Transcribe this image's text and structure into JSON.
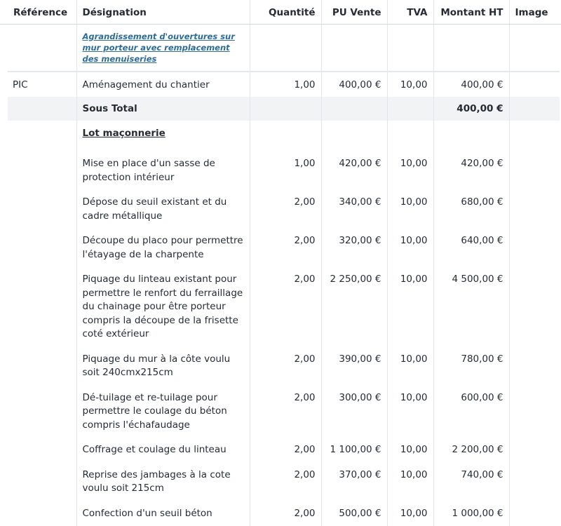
{
  "columns": {
    "reference": "Référence",
    "designation": "Désignation",
    "quantite": "Quantité",
    "pu_vente": "PU Vente",
    "tva": "TVA",
    "montant_ht": "Montant HT",
    "image": "Image"
  },
  "title_row": {
    "link_text": "Agrandissement d'ouvertures sur mur porteur avec remplacement des menuiseries"
  },
  "pic_row": {
    "reference": "PIC",
    "designation": "Aménagement du chantier",
    "quantite": "1,00",
    "pu_vente": "400,00 €",
    "tva": "10,00",
    "montant_ht": "400,00 €"
  },
  "subtotal": {
    "label": "Sous Total",
    "montant_ht": "400,00 €"
  },
  "lot": {
    "title": "Lot maçonnerie",
    "items": [
      {
        "designation": "Mise en place d'un sasse de protection intérieur",
        "quantite": "1,00",
        "pu_vente": "420,00 €",
        "tva": "10,00",
        "montant_ht": "420,00 €"
      },
      {
        "designation": "Dépose du seuil existant et du cadre métallique",
        "quantite": "2,00",
        "pu_vente": "340,00 €",
        "tva": "10,00",
        "montant_ht": "680,00 €"
      },
      {
        "designation": "Découpe du placo pour permettre l'étayage de la charpente",
        "quantite": "2,00",
        "pu_vente": "320,00 €",
        "tva": "10,00",
        "montant_ht": "640,00 €"
      },
      {
        "designation": "Piquage du linteau existant pour permettre le renfort du ferraillage du chainage pour être porteur compris la découpe de la frisette coté extérieur",
        "quantite": "2,00",
        "pu_vente": "2 250,00 €",
        "tva": "10,00",
        "montant_ht": "4 500,00 €"
      },
      {
        "designation": "Piquage du mur à la côte voulu soit 240cmx215cm",
        "quantite": "2,00",
        "pu_vente": "390,00 €",
        "tva": "10,00",
        "montant_ht": "780,00 €"
      },
      {
        "designation": "Dé-tuilage et re-tuilage pour permettre le coulage du béton compris l'échafaudage",
        "quantite": "2,00",
        "pu_vente": "300,00 €",
        "tva": "10,00",
        "montant_ht": "600,00 €"
      },
      {
        "designation": "Coffrage et coulage du linteau",
        "quantite": "2,00",
        "pu_vente": "1 100,00 €",
        "tva": "10,00",
        "montant_ht": "2 200,00 €"
      },
      {
        "designation": "Reprise des jambages à la cote voulu soit 215cm",
        "quantite": "2,00",
        "pu_vente": "370,00 €",
        "tva": "10,00",
        "montant_ht": "740,00 €"
      },
      {
        "designation": "Confection d'un seuil béton",
        "quantite": "2,00",
        "pu_vente": "500,00 €",
        "tva": "10,00",
        "montant_ht": "1 000,00 €"
      }
    ]
  }
}
